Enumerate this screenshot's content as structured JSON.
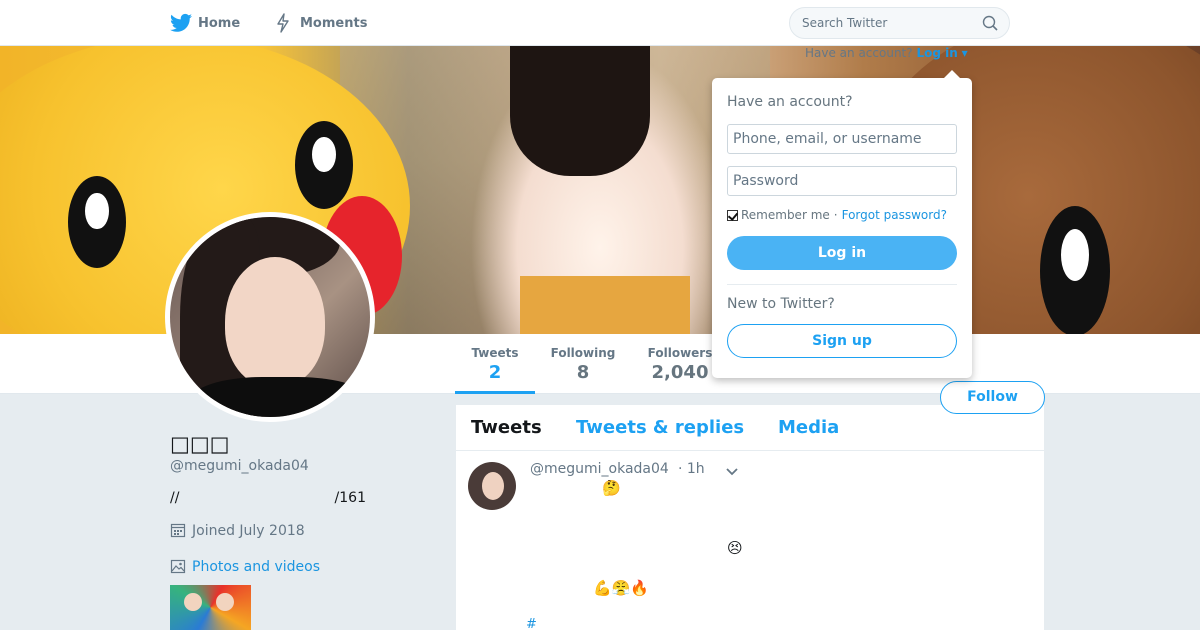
{
  "nav": {
    "home_label": "Home",
    "moments_label": "Moments",
    "search_placeholder": "Search Twitter"
  },
  "login_link": {
    "prefix": "Have an account?",
    "action": "Log in"
  },
  "login_dropdown": {
    "title": "Have an account?",
    "username_placeholder": "Phone, email, or username",
    "password_placeholder": "Password",
    "remember_label": "Remember me",
    "separator": "·",
    "forgot_label": "Forgot password?",
    "login_button": "Log in",
    "new_label": "New to Twitter?",
    "signup_button": "Sign up"
  },
  "profile": {
    "name": "□□□",
    "handle": "@megumi_okada04",
    "bio_left": "//",
    "bio_right": "/161",
    "joined": "Joined July 2018",
    "photos_label": "Photos and videos"
  },
  "stats": [
    {
      "label": "Tweets",
      "value": "2"
    },
    {
      "label": "Following",
      "value": "8"
    },
    {
      "label": "Followers",
      "value": "2,040"
    }
  ],
  "follow_button": "Follow",
  "tabs": {
    "tweets": "Tweets",
    "replies": "Tweets & replies",
    "media": "Media"
  },
  "tweet": {
    "handle": "@megumi_okada04",
    "time": "· 1h",
    "emoji_1": "🤔",
    "emoji_2": "😣",
    "emoji_3": "💪😤🔥",
    "hashtag": "#"
  },
  "colors": {
    "accent": "#1da1f2",
    "link": "#1b95e0",
    "login_button": "#4ab3f4",
    "background": "#e6ecf0"
  },
  "icons": [
    "twitter-bird-icon",
    "lightning-icon",
    "search-icon",
    "calendar-icon",
    "image-icon",
    "chevron-down-icon",
    "caret-down-icon"
  ]
}
